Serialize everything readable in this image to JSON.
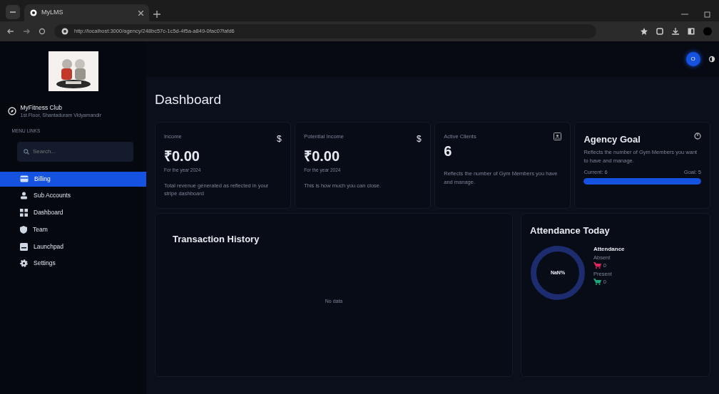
{
  "browser": {
    "tab_title": "MyLMS",
    "url": "http://localhost:3000/agency/248bc57c-1c5d-4f5a-a849-0fac07fafd6"
  },
  "sidebar": {
    "club_name": "MyFitness Club",
    "club_address": "1st Floor, Shantaduram Vidyamandir",
    "section_label": "MENU LINKS",
    "search": {
      "placeholder": "Search..."
    },
    "items": [
      {
        "label": "Billing",
        "selected": true
      },
      {
        "label": "Sub Accounts",
        "selected": false
      },
      {
        "label": "Dashboard",
        "selected": false
      },
      {
        "label": "Team",
        "selected": false
      },
      {
        "label": "Launchpad",
        "selected": false
      },
      {
        "label": "Settings",
        "selected": false
      }
    ]
  },
  "header": {
    "avatar": "O"
  },
  "page_title": "Dashboard",
  "stat_cards": [
    {
      "kind": "stat",
      "label": "Income",
      "symbol": "$",
      "value": "₹0.00",
      "period": "For the year 2024",
      "description": "Total revenue generated as reflected in your stripe dashboard"
    },
    {
      "kind": "stat",
      "label": "Potential Income",
      "symbol": "$",
      "value": "₹0.00",
      "period": "For the year 2024",
      "description": "This is how much you can close."
    },
    {
      "kind": "stat",
      "label": "Active Clients",
      "value": "6",
      "description": "Reflects the number of Gym Members you have and manage."
    },
    {
      "kind": "goal",
      "title": "Agency Goal",
      "description": "Reflects the number of Gym Members you want to have and manage.",
      "current": "Current: 6",
      "goal": "Goal: 5",
      "level": 1
    }
  ],
  "transactions": {
    "title": "Transaction History",
    "empty_text": "No data"
  },
  "attendance": {
    "title": "Attendance Today",
    "center_text": "NaN%",
    "legend_title": "Attendance",
    "legend": [
      {
        "label": "Absent",
        "value": "0",
        "color": "#e0245e"
      },
      {
        "label": "Present",
        "value": "0",
        "color": "#1fa97a"
      }
    ]
  }
}
